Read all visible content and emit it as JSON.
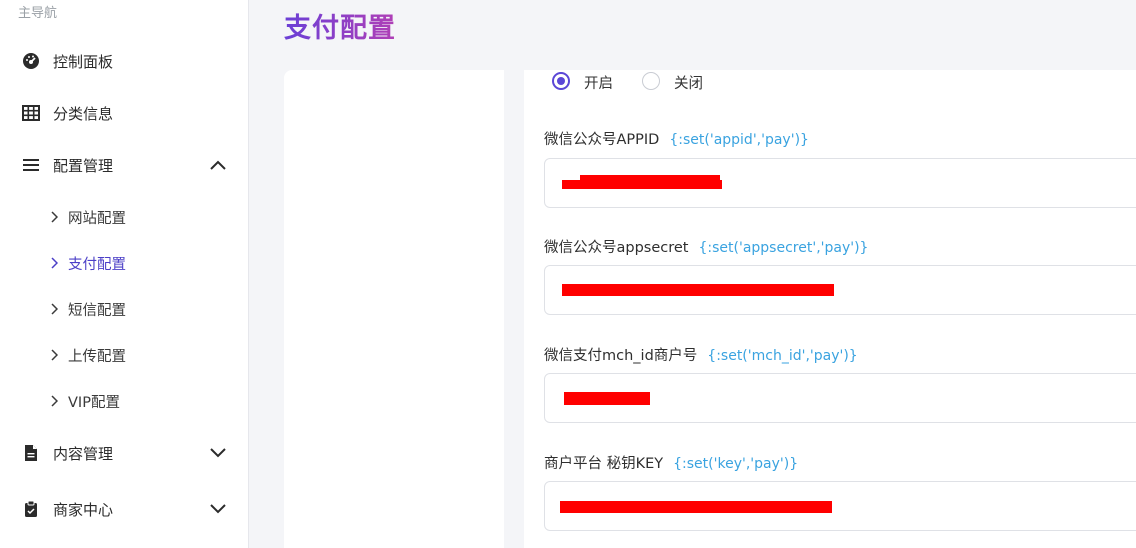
{
  "sidebar": {
    "section_label": "主导航",
    "items": [
      {
        "label": "控制面板",
        "icon": "dashboard-icon"
      },
      {
        "label": "分类信息",
        "icon": "grid-icon"
      },
      {
        "label": "配置管理",
        "icon": "menu-icon",
        "expanded": true
      },
      {
        "label": "内容管理",
        "icon": "document-icon",
        "expanded": false
      },
      {
        "label": "商家中心",
        "icon": "clipboard-icon",
        "expanded": false
      }
    ],
    "sub_items": [
      {
        "label": "网站配置",
        "active": false
      },
      {
        "label": "支付配置",
        "active": true
      },
      {
        "label": "短信配置",
        "active": false
      },
      {
        "label": "上传配置",
        "active": false
      },
      {
        "label": "VIP配置",
        "active": false
      }
    ]
  },
  "main": {
    "title": "支付配置",
    "radio": {
      "on_label": "开启",
      "off_label": "关闭",
      "selected": "开启"
    },
    "fields": [
      {
        "label": "微信公众号APPID",
        "tag": "{:set('appid','pay')}",
        "value": ""
      },
      {
        "label": "微信公众号appsecret",
        "tag": "{:set('appsecret','pay')}",
        "value": ""
      },
      {
        "label": "微信支付mch_id商户号",
        "tag": "{:set('mch_id','pay')}",
        "value": ""
      },
      {
        "label": "商户平台 秘钥KEY",
        "tag": "{:set('key','pay')}",
        "value": ""
      }
    ]
  },
  "colors": {
    "accent": "#5b47d6",
    "active_nav": "#4b3fc7",
    "tag": "#3aa3e0",
    "redaction": "#ff0000"
  }
}
